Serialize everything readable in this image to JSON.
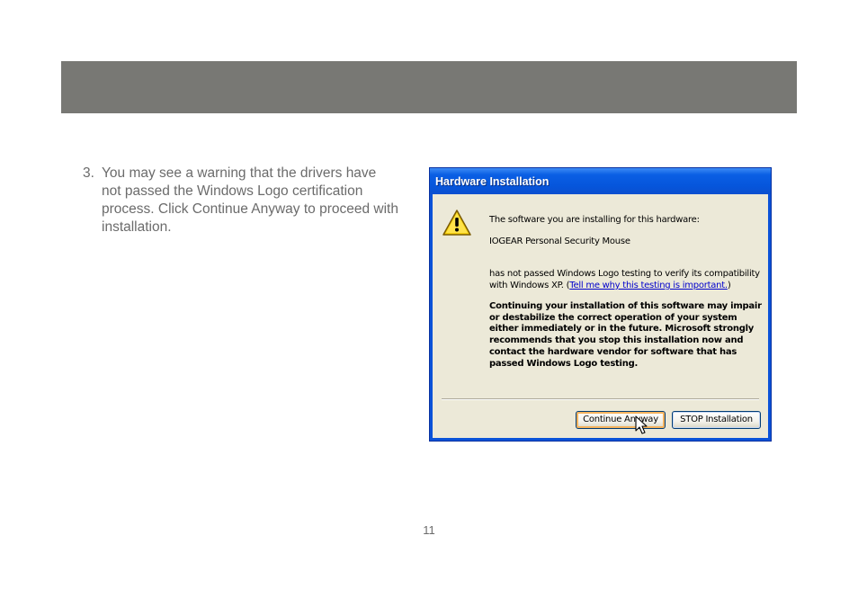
{
  "step": {
    "number": "3.",
    "text": "You may see a warning that the drivers have not passed the Windows Logo certification process.  Click Continue Anyway to proceed with installation."
  },
  "dialog": {
    "title": "Hardware Installation",
    "icon": "warning-icon",
    "message_intro": "The software you are installing for this hardware:",
    "device_name": "IOGEAR Personal Security Mouse",
    "message_line1": "has not passed Windows Logo testing to verify its compatibility",
    "message_line2_prefix": "with Windows XP. (",
    "link_text": "Tell me why this testing is important.",
    "message_line2_suffix": ")",
    "warning_text": "Continuing your installation of this software may impair or destabilize the correct operation of your system either immediately or in the future. Microsoft strongly recommends that you stop this installation now and contact the hardware vendor for software that has passed Windows Logo testing.",
    "buttons": {
      "continue": "Continue Anyway",
      "stop": "STOP Installation"
    }
  },
  "page_number": "11",
  "colors": {
    "header_band": "#787874",
    "titlebar": "#0a5fe4",
    "dialog_body": "#ece9d8"
  }
}
